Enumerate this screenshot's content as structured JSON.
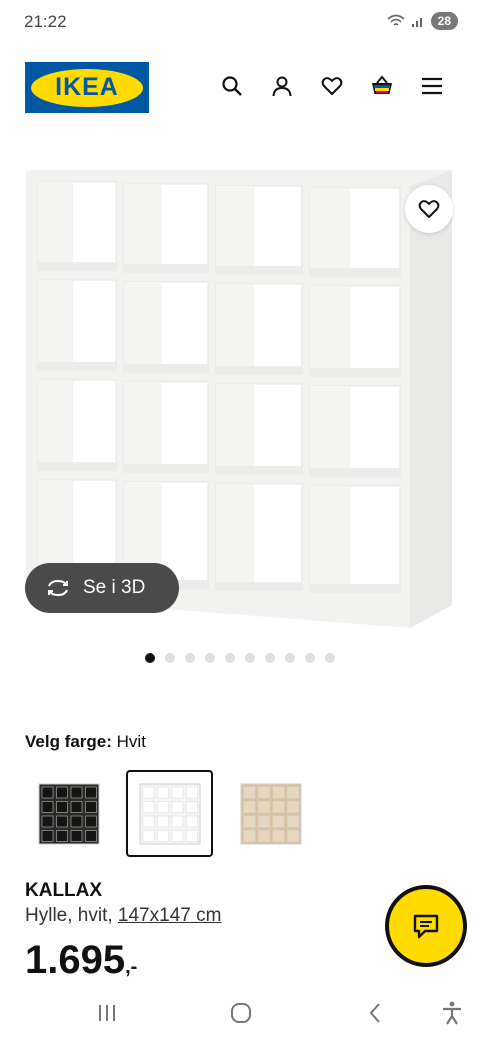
{
  "status_bar": {
    "time": "21:22",
    "wifi_icon": "wifi-icon",
    "signal_icon": "signal-icon",
    "battery": "28"
  },
  "header": {
    "logo_text": "IKEA",
    "icons": [
      "search-icon",
      "user-icon",
      "heart-icon",
      "basket-icon",
      "menu-icon"
    ]
  },
  "colors": {
    "brand_blue": "#0058a3",
    "brand_yellow": "#ffdb00",
    "pill_bg": "#4a4a4a"
  },
  "gallery": {
    "view3d_label": "Se i 3D",
    "dot_count": 10,
    "active_dot": 1
  },
  "color_picker": {
    "label": "Velg farge:",
    "value": "Hvit",
    "options": [
      {
        "name": "black-brown",
        "color": "#2b2a28"
      },
      {
        "name": "white",
        "color": "#f4f4f2"
      },
      {
        "name": "oak-effect",
        "color": "#d8c2a3"
      }
    ],
    "selected_index": 1
  },
  "product": {
    "name": "KALLAX",
    "desc_prefix": "Hylle, hvit, ",
    "dimensions": "147x147 cm",
    "price_main": "1.695",
    "price_suffix": ",-"
  }
}
